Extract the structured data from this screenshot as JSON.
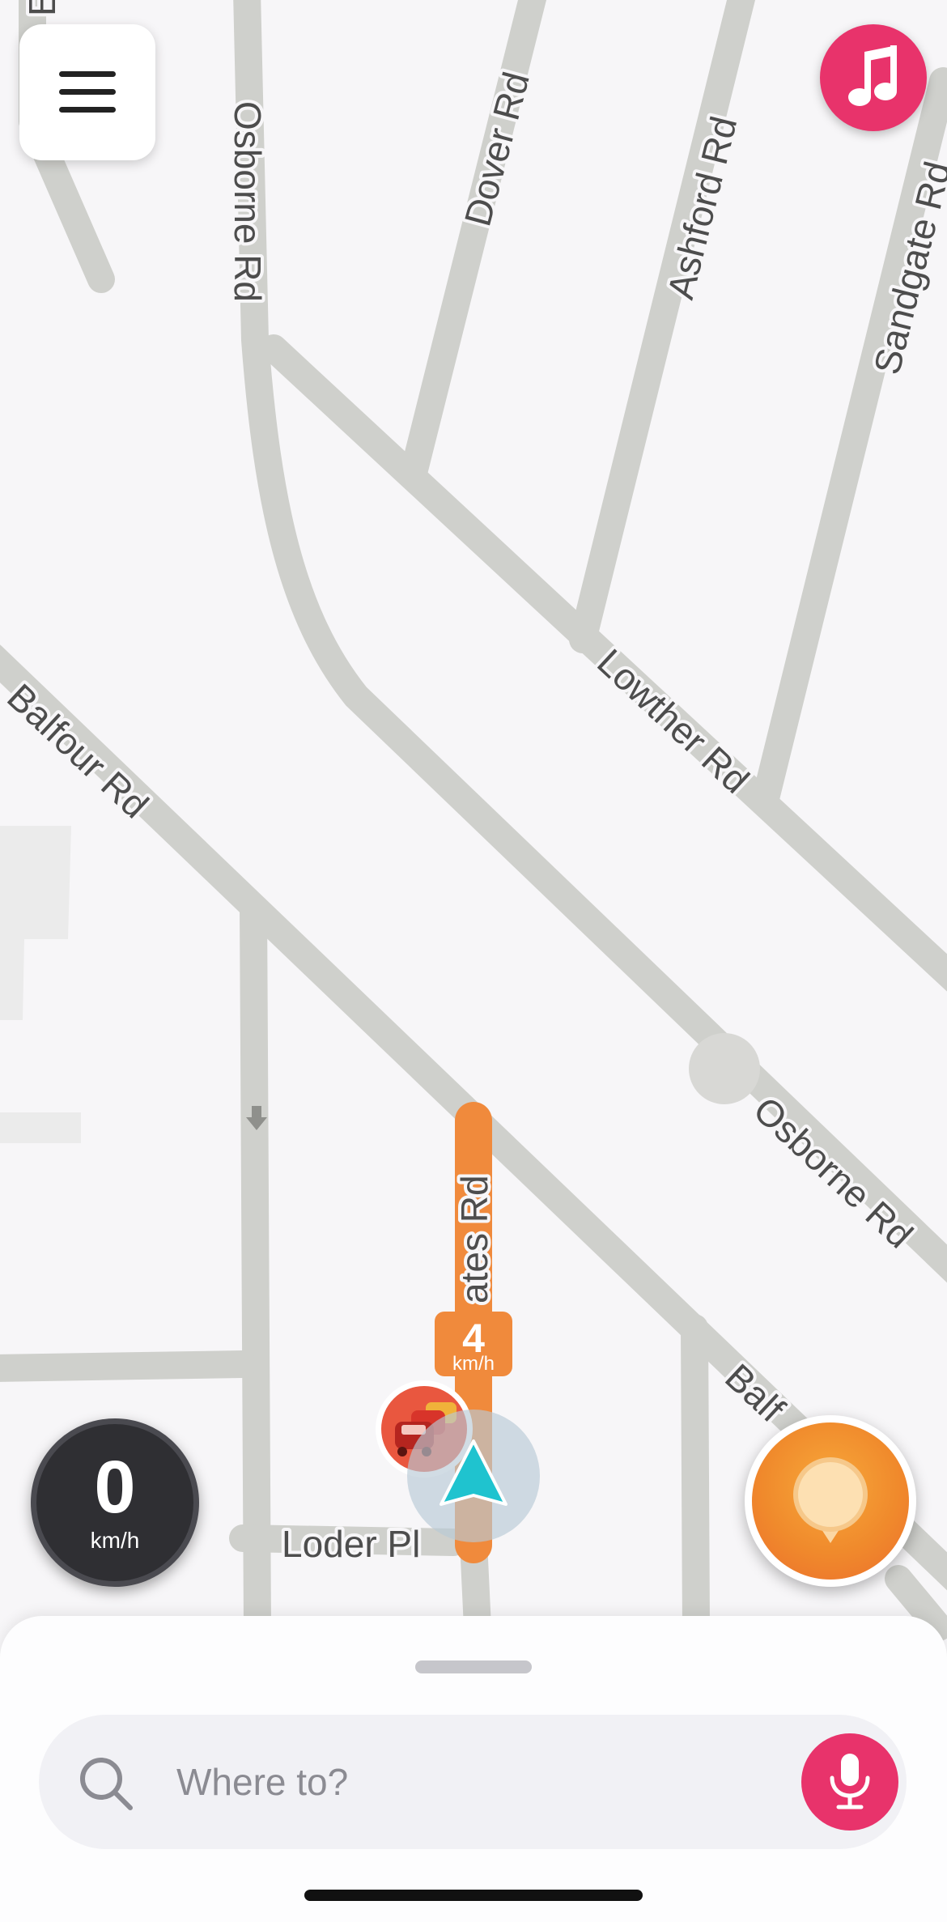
{
  "map": {
    "streets": [
      {
        "id": "osborne-rd-north",
        "label": "Osborne Rd"
      },
      {
        "id": "dover-rd",
        "label": "Dover Rd"
      },
      {
        "id": "ashford-rd",
        "label": "Ashford Rd"
      },
      {
        "id": "sandgate-rd",
        "label": "Sandgate Rd"
      },
      {
        "id": "lowther-rd",
        "label": "Lowther Rd"
      },
      {
        "id": "balfour-rd",
        "label": "Balfour Rd"
      },
      {
        "id": "osborne-rd-south",
        "label": "Osborne Rd"
      },
      {
        "id": "yates-rd",
        "label": "ates Rd"
      },
      {
        "id": "loder-pl",
        "label": "Loder Pl"
      },
      {
        "id": "balfour-rd-2",
        "label": "Balf"
      },
      {
        "id": "partial-top-left",
        "label": "E"
      }
    ],
    "traffic_speed": {
      "value": "4",
      "unit": "km/h"
    }
  },
  "speedometer": {
    "value": "0",
    "unit": "km/h"
  },
  "search": {
    "placeholder": "Where to?"
  },
  "colors": {
    "road": "#cfd0cc",
    "map_background": "#f7f6f8",
    "traffic": "#f08a3c",
    "accent_pink": "#e8336b",
    "vehicle_arrow": "#1fc3cf",
    "report_orange": "#f08a2c"
  },
  "icons": {
    "menu": "hamburger-icon",
    "music": "music-note-icon",
    "report": "report-bubble-icon",
    "search": "search-icon",
    "mic": "microphone-icon",
    "traffic_jam": "traffic-jam-icon",
    "vehicle": "navigation-arrow-icon"
  }
}
